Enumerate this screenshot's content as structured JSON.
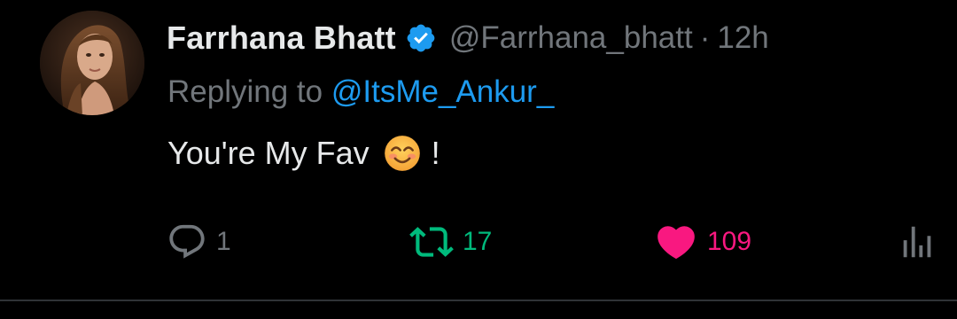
{
  "author": {
    "name": "Farrhana Bhatt",
    "handle": "@Farrhana_bhatt",
    "separator": "·",
    "time": "12h",
    "verified": true
  },
  "reply": {
    "prefix": "Replying to",
    "mention": "@ItsMe_Ankur_"
  },
  "tweet": {
    "text": "You're My Fav",
    "emoji_icon": "smiling-face-emoji",
    "suffix": "!"
  },
  "actions": {
    "reply_count": "1",
    "retweet_count": "17",
    "like_count": "109",
    "views_icon": "bar-chart-icon"
  },
  "colors": {
    "background": "#000000",
    "text": "#e7e9ea",
    "muted": "#71767b",
    "link": "#1d9bf0",
    "retweet": "#00ba7c",
    "like": "#f91880",
    "verified": "#1d9bf0",
    "divider": "#2f3336"
  }
}
